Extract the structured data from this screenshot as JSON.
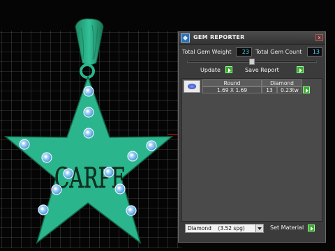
{
  "pendant": {
    "engraving": "CARPE",
    "colors": {
      "metal": "#2bb58c",
      "metal_dark": "#16744f",
      "gem": "#9fd1f7",
      "grid": "#d9d9d9",
      "axis": "#d42020"
    }
  },
  "gem_reporter": {
    "title": "GEM REPORTER",
    "close_label": "x",
    "total_gem_weight_label": "Total Gem Weight",
    "total_gem_weight_value": "23",
    "total_gem_count_label": "Total Gem Count",
    "total_gem_count_value": "13",
    "update_label": "Update",
    "save_report_label": "Save Report",
    "gem_row": {
      "cut_header": "Round",
      "type_header": "Diamond",
      "size": "1.69 X 1.69",
      "count": "13",
      "weight": "0.23tw"
    },
    "material_selected": "Diamond    (3.52 spg)",
    "set_material_label": "Set Material",
    "colors": {
      "value_text": "#4fd3ff",
      "go_button": "#3caa2f"
    }
  }
}
